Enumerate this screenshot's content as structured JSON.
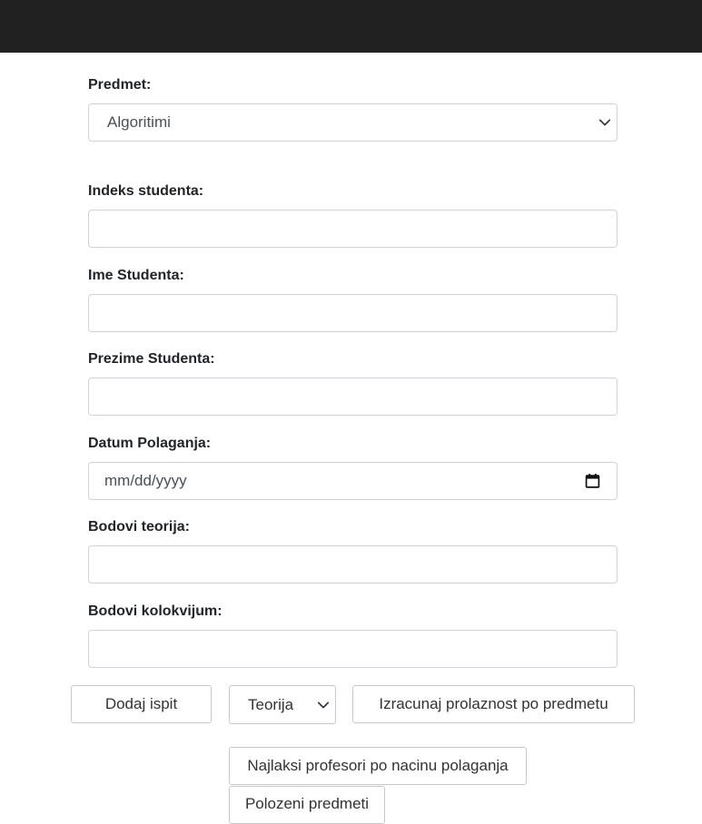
{
  "form": {
    "subject_label": "Predmet:",
    "subject_value": "Algoritimi",
    "index_label": "Indeks studenta:",
    "index_value": "",
    "first_name_label": "Ime Studenta:",
    "first_name_value": "",
    "last_name_label": "Prezime Studenta:",
    "last_name_value": "",
    "exam_date_label": "Datum Polaganja:",
    "exam_date_placeholder": "mm/dd/yyyy",
    "theory_points_label": "Bodovi teorija:",
    "theory_points_value": "",
    "colloquium_points_label": "Bodovi kolokvijum:",
    "colloquium_points_value": ""
  },
  "actions": {
    "add_exam": "Dodaj ispit",
    "exam_type_value": "Teorija",
    "calc_pass_rate": "Izracunaj prolaznost po predmetu",
    "easiest_professors": "Najlaksi profesori po nacinu polaganja",
    "passed_subjects": "Polozeni predmeti"
  },
  "icons": {
    "select_arrow": "chevron-down-icon",
    "date_picker": "calendar-icon"
  },
  "colors": {
    "topbar": "#212121",
    "field_border": "#ced4da",
    "button_border": "#c8c8c8"
  }
}
